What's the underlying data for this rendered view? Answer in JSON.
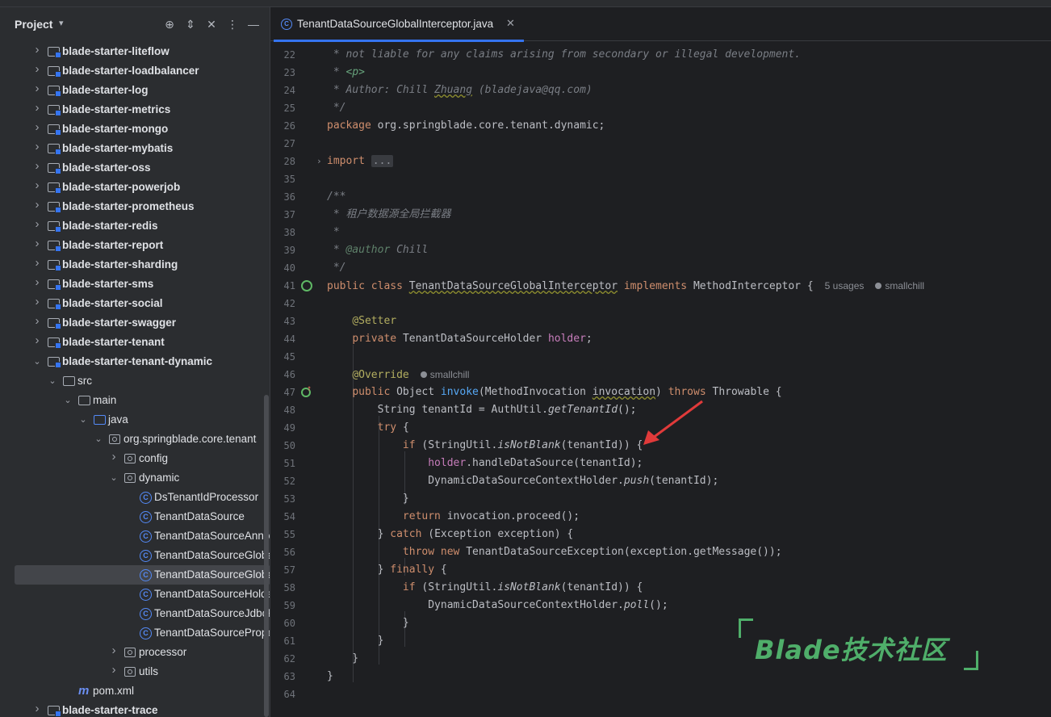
{
  "project_panel": {
    "title": "Project",
    "tree": [
      {
        "label": "blade-starter-liteflow",
        "type": "module",
        "depth": 0,
        "state": "collapsed"
      },
      {
        "label": "blade-starter-loadbalancer",
        "type": "module",
        "depth": 0,
        "state": "collapsed"
      },
      {
        "label": "blade-starter-log",
        "type": "module",
        "depth": 0,
        "state": "collapsed"
      },
      {
        "label": "blade-starter-metrics",
        "type": "module",
        "depth": 0,
        "state": "collapsed"
      },
      {
        "label": "blade-starter-mongo",
        "type": "module",
        "depth": 0,
        "state": "collapsed"
      },
      {
        "label": "blade-starter-mybatis",
        "type": "module",
        "depth": 0,
        "state": "collapsed"
      },
      {
        "label": "blade-starter-oss",
        "type": "module",
        "depth": 0,
        "state": "collapsed"
      },
      {
        "label": "blade-starter-powerjob",
        "type": "module",
        "depth": 0,
        "state": "collapsed"
      },
      {
        "label": "blade-starter-prometheus",
        "type": "module",
        "depth": 0,
        "state": "collapsed"
      },
      {
        "label": "blade-starter-redis",
        "type": "module",
        "depth": 0,
        "state": "collapsed"
      },
      {
        "label": "blade-starter-report",
        "type": "module",
        "depth": 0,
        "state": "collapsed"
      },
      {
        "label": "blade-starter-sharding",
        "type": "module",
        "depth": 0,
        "state": "collapsed"
      },
      {
        "label": "blade-starter-sms",
        "type": "module",
        "depth": 0,
        "state": "collapsed"
      },
      {
        "label": "blade-starter-social",
        "type": "module",
        "depth": 0,
        "state": "collapsed"
      },
      {
        "label": "blade-starter-swagger",
        "type": "module",
        "depth": 0,
        "state": "collapsed"
      },
      {
        "label": "blade-starter-tenant",
        "type": "module",
        "depth": 0,
        "state": "collapsed"
      },
      {
        "label": "blade-starter-tenant-dynamic",
        "type": "module",
        "depth": 0,
        "state": "expanded"
      },
      {
        "label": "src",
        "type": "folder",
        "depth": 1,
        "state": "expanded"
      },
      {
        "label": "main",
        "type": "folder",
        "depth": 2,
        "state": "expanded"
      },
      {
        "label": "java",
        "type": "folder-blue",
        "depth": 3,
        "state": "expanded"
      },
      {
        "label": "org.springblade.core.tenant",
        "type": "package",
        "depth": 4,
        "state": "expanded"
      },
      {
        "label": "config",
        "type": "package",
        "depth": 5,
        "state": "collapsed"
      },
      {
        "label": "dynamic",
        "type": "package",
        "depth": 5,
        "state": "expanded"
      },
      {
        "label": "DsTenantIdProcessor",
        "type": "class",
        "depth": 6,
        "state": "none"
      },
      {
        "label": "TenantDataSource",
        "type": "class",
        "depth": 6,
        "state": "none"
      },
      {
        "label": "TenantDataSourceAnnotation",
        "type": "class",
        "depth": 6,
        "state": "none"
      },
      {
        "label": "TenantDataSourceGlobalAdvisor",
        "type": "class",
        "depth": 6,
        "state": "none"
      },
      {
        "label": "TenantDataSourceGlobalInterceptor",
        "type": "class",
        "depth": 6,
        "state": "none",
        "selected": true
      },
      {
        "label": "TenantDataSourceHolder",
        "type": "class",
        "depth": 6,
        "state": "none"
      },
      {
        "label": "TenantDataSourceJdbcProvider",
        "type": "class",
        "depth": 6,
        "state": "none"
      },
      {
        "label": "TenantDataSourceProperties",
        "type": "class",
        "depth": 6,
        "state": "none"
      },
      {
        "label": "processor",
        "type": "package",
        "depth": 5,
        "state": "collapsed"
      },
      {
        "label": "utils",
        "type": "package",
        "depth": 5,
        "state": "collapsed"
      },
      {
        "label": "pom.xml",
        "type": "maven",
        "depth": 2,
        "state": "none"
      },
      {
        "label": "blade-starter-trace",
        "type": "module",
        "depth": 0,
        "state": "collapsed"
      }
    ]
  },
  "editor": {
    "tab_label": "TenantDataSourceGlobalInterceptor.java",
    "tab_icon_glyph": "C",
    "usages_hint": "5 usages",
    "author_hint": "smallchill",
    "override_hint": "smallchill",
    "lines": [
      {
        "n": "22",
        "parts": [
          [
            "cm",
            " * not liable for any claims arising from secondary or illegal development."
          ]
        ]
      },
      {
        "n": "23",
        "parts": [
          [
            "cm",
            " * "
          ],
          [
            "cm-tag",
            "<p>"
          ]
        ]
      },
      {
        "n": "24",
        "parts": [
          [
            "cm",
            " * Author: Chill "
          ],
          [
            "cm wavy",
            "Zhuang"
          ],
          [
            "cm",
            " (bladejava@qq.com)"
          ]
        ]
      },
      {
        "n": "25",
        "parts": [
          [
            "cm",
            " */"
          ]
        ]
      },
      {
        "n": "26",
        "parts": [
          [
            "kw",
            "package "
          ],
          [
            "plain",
            "org.springblade.core.tenant.dynamic;"
          ]
        ]
      },
      {
        "n": "27",
        "parts": []
      },
      {
        "n": "28",
        "parts": [
          [
            "kw",
            "import "
          ],
          [
            "fold-box",
            "..."
          ]
        ]
      },
      {
        "n": "35",
        "parts": []
      },
      {
        "n": "36",
        "parts": [
          [
            "cm",
            "/**"
          ]
        ]
      },
      {
        "n": "37",
        "parts": [
          [
            "cm",
            " * 租户数据源全局拦截器"
          ]
        ]
      },
      {
        "n": "38",
        "parts": [
          [
            "cm",
            " *"
          ]
        ]
      },
      {
        "n": "39",
        "parts": [
          [
            "cm",
            " * "
          ],
          [
            "cm-doc",
            "@author"
          ],
          [
            "cm",
            " Chill"
          ]
        ]
      },
      {
        "n": "40",
        "parts": [
          [
            "cm",
            " */"
          ]
        ]
      },
      {
        "n": "41",
        "parts": [
          [
            "kw",
            "public class "
          ],
          [
            "plain wavy",
            "TenantDataSourceGlobalInterceptor"
          ],
          [
            "kw",
            " implements "
          ],
          [
            "plain",
            "MethodInterceptor {"
          ]
        ]
      },
      {
        "n": "42",
        "parts": []
      },
      {
        "n": "43",
        "parts": [
          [
            "plain",
            "    "
          ],
          [
            "anno",
            "@Setter"
          ]
        ]
      },
      {
        "n": "44",
        "parts": [
          [
            "plain",
            "    "
          ],
          [
            "kw",
            "private "
          ],
          [
            "plain",
            "TenantDataSourceHolder "
          ],
          [
            "fld",
            "holder"
          ],
          [
            "plain",
            ";"
          ]
        ]
      },
      {
        "n": "45",
        "parts": []
      },
      {
        "n": "46",
        "parts": [
          [
            "plain",
            "    "
          ],
          [
            "anno",
            "@Override"
          ]
        ]
      },
      {
        "n": "47",
        "parts": [
          [
            "plain",
            "    "
          ],
          [
            "kw",
            "public "
          ],
          [
            "plain",
            "Object "
          ],
          [
            "fn",
            "invoke"
          ],
          [
            "plain",
            "(MethodInvocation "
          ],
          [
            "plain wavy",
            "invocation"
          ],
          [
            "plain",
            ") "
          ],
          [
            "kw",
            "throws "
          ],
          [
            "plain",
            "Throwable {"
          ]
        ]
      },
      {
        "n": "48",
        "parts": [
          [
            "plain",
            "        String tenantId = AuthUtil."
          ],
          [
            "sfn",
            "getTenantId"
          ],
          [
            "plain",
            "();"
          ]
        ]
      },
      {
        "n": "49",
        "parts": [
          [
            "plain",
            "        "
          ],
          [
            "kw",
            "try "
          ],
          [
            "plain",
            "{"
          ]
        ]
      },
      {
        "n": "50",
        "parts": [
          [
            "plain",
            "            "
          ],
          [
            "kw",
            "if "
          ],
          [
            "plain",
            "(StringUtil."
          ],
          [
            "sfn",
            "isNotBlank"
          ],
          [
            "plain",
            "(tenantId)) {"
          ]
        ]
      },
      {
        "n": "51",
        "parts": [
          [
            "plain",
            "                "
          ],
          [
            "fld",
            "holder"
          ],
          [
            "plain",
            ".handleDataSource(tenantId);"
          ]
        ]
      },
      {
        "n": "52",
        "parts": [
          [
            "plain",
            "                DynamicDataSourceContextHolder."
          ],
          [
            "sfn",
            "push"
          ],
          [
            "plain",
            "(tenantId);"
          ]
        ]
      },
      {
        "n": "53",
        "parts": [
          [
            "plain",
            "            }"
          ]
        ]
      },
      {
        "n": "54",
        "parts": [
          [
            "plain",
            "            "
          ],
          [
            "kw",
            "return "
          ],
          [
            "plain",
            "invocation.proceed();"
          ]
        ]
      },
      {
        "n": "55",
        "parts": [
          [
            "plain",
            "        } "
          ],
          [
            "kw",
            "catch "
          ],
          [
            "plain",
            "(Exception exception) {"
          ]
        ]
      },
      {
        "n": "56",
        "parts": [
          [
            "plain",
            "            "
          ],
          [
            "kw",
            "throw new "
          ],
          [
            "plain",
            "TenantDataSourceException(exception.getMessage());"
          ]
        ]
      },
      {
        "n": "57",
        "parts": [
          [
            "plain",
            "        } "
          ],
          [
            "kw",
            "finally "
          ],
          [
            "plain",
            "{"
          ]
        ]
      },
      {
        "n": "58",
        "parts": [
          [
            "plain",
            "            "
          ],
          [
            "kw",
            "if "
          ],
          [
            "plain",
            "(StringUtil."
          ],
          [
            "sfn",
            "isNotBlank"
          ],
          [
            "plain",
            "(tenantId)) {"
          ]
        ]
      },
      {
        "n": "59",
        "parts": [
          [
            "plain",
            "                DynamicDataSourceContextHolder."
          ],
          [
            "sfn",
            "poll"
          ],
          [
            "plain",
            "();"
          ]
        ]
      },
      {
        "n": "60",
        "parts": [
          [
            "plain",
            "            }"
          ]
        ]
      },
      {
        "n": "61",
        "parts": [
          [
            "plain",
            "        }"
          ]
        ]
      },
      {
        "n": "62",
        "parts": [
          [
            "plain",
            "    }"
          ]
        ]
      },
      {
        "n": "63",
        "parts": [
          [
            "plain",
            "}"
          ]
        ]
      },
      {
        "n": "64",
        "parts": []
      }
    ]
  },
  "watermark": {
    "text": "Blade技术社区"
  },
  "colors": {
    "accent": "#3574f0",
    "arrow": "#e03a3a",
    "watermark": "#4fae6a"
  },
  "icons": [
    "chevron-down-icon",
    "locate-icon",
    "expand-collapse-icon",
    "close-icon",
    "more-icon",
    "minimize-icon",
    "class-icon",
    "folder-icon",
    "module-icon",
    "package-icon",
    "maven-icon",
    "implemented-icon",
    "override-icon",
    "user-icon"
  ]
}
